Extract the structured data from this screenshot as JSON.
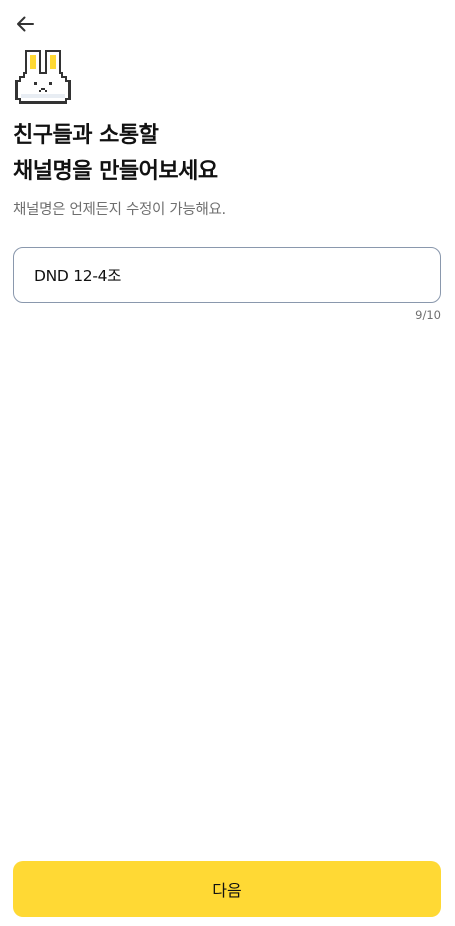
{
  "header": {
    "back_icon": "arrow-left-icon"
  },
  "mascot": {
    "icon": "bunny-icon",
    "colors": {
      "body": "#ffffff",
      "outline": "#333333",
      "ear_inner": "#ffd934"
    }
  },
  "main": {
    "title_line1": "친구들과 소통할",
    "title_line2": "채널명을 만들어보세요",
    "subtitle": "채널명은 언제든지 수정이 가능해요."
  },
  "channel_name": {
    "value": "DND 12-4조",
    "counter": "9/10"
  },
  "footer": {
    "next_label": "다음"
  },
  "colors": {
    "accent": "#ffd934",
    "input_border": "#8a98ad",
    "muted_text": "#6f6f6f"
  }
}
